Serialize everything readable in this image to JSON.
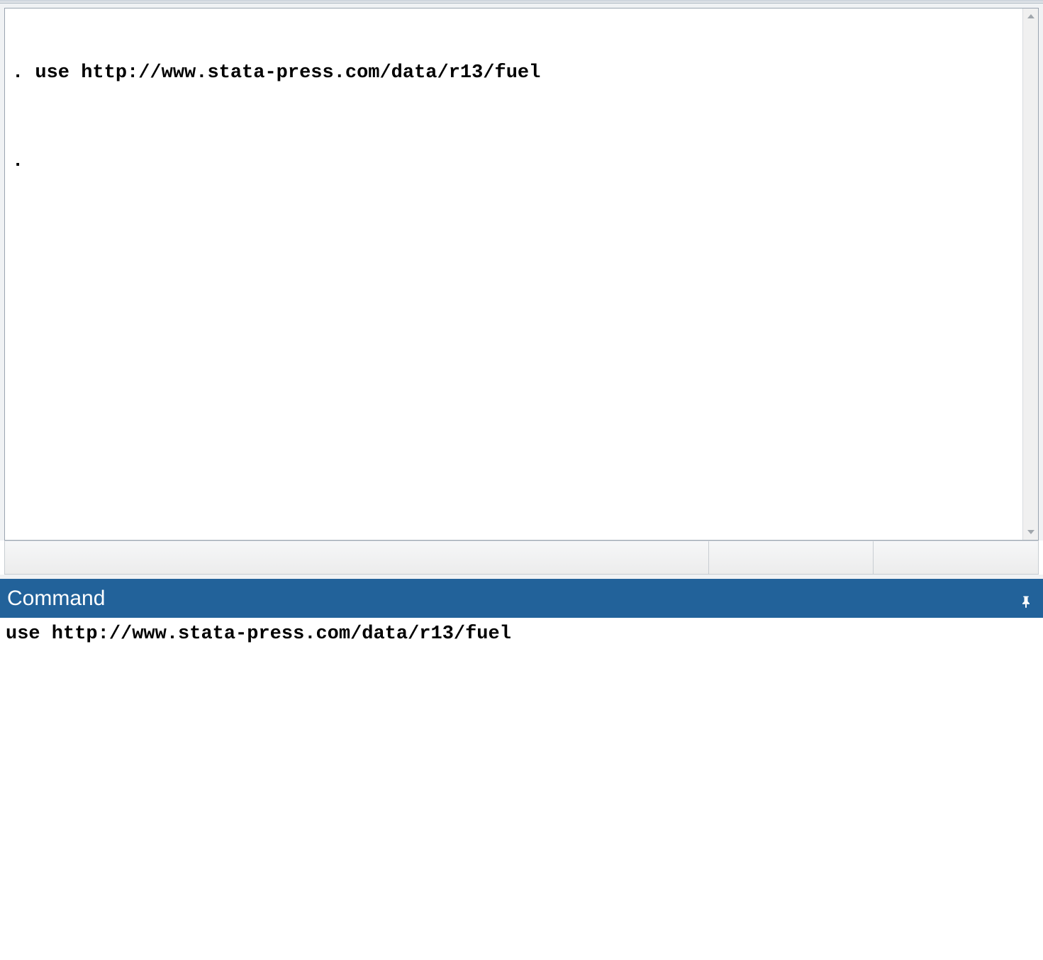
{
  "results": {
    "lines": [
      ". use http://www.stata-press.com/data/r13/fuel",
      "."
    ]
  },
  "command_panel": {
    "title": "Command",
    "input_value": "use http://www.stata-press.com/data/r13/fuel"
  }
}
